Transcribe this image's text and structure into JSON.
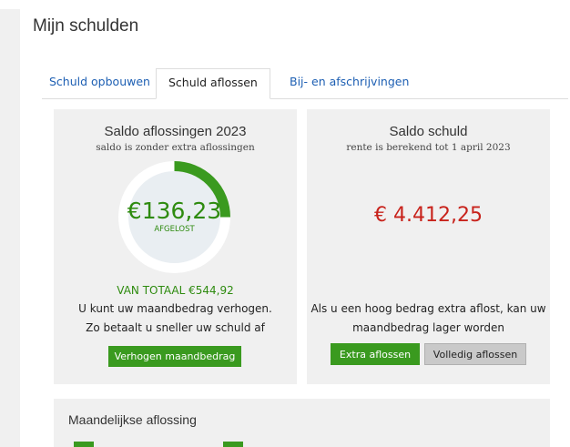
{
  "page": {
    "title": "Mijn schulden"
  },
  "tabs": [
    {
      "label": "Schuld opbouwen",
      "active": false
    },
    {
      "label": "Schuld aflossen",
      "active": true
    },
    {
      "label": "Bij- en afschrijvingen",
      "active": false
    }
  ],
  "repayment_card": {
    "title": "Saldo aflossingen 2023",
    "subtitle": "saldo is zonder extra aflossingen",
    "amount": "€136,23",
    "amount_label": "AFGELOST",
    "progress_fraction": 0.25,
    "total_text": "VAN TOTAAL €544,92",
    "line1": "U kunt uw maandbedrag verhogen.",
    "line2": "Zo betaalt u sneller uw schuld af",
    "button_label": "Verhogen maandbedrag"
  },
  "debt_card": {
    "title": "Saldo schuld",
    "subtitle": "rente is berekend tot 1 april 2023",
    "amount": "€ 4.412,25",
    "line1": "Als u een hoog bedrag extra aflost, kan uw",
    "line2": "maandbedrag lager worden",
    "extra_button_label": "Extra aflossen",
    "full_button_label": "Volledig aflossen"
  },
  "monthly_card": {
    "title": "Maandelijkse aflossing"
  },
  "colors": {
    "accent_green": "#3a9a1f",
    "debt_red": "#c8231c",
    "link_blue": "#1d5fb3",
    "card_bg": "#f0f0f0"
  }
}
